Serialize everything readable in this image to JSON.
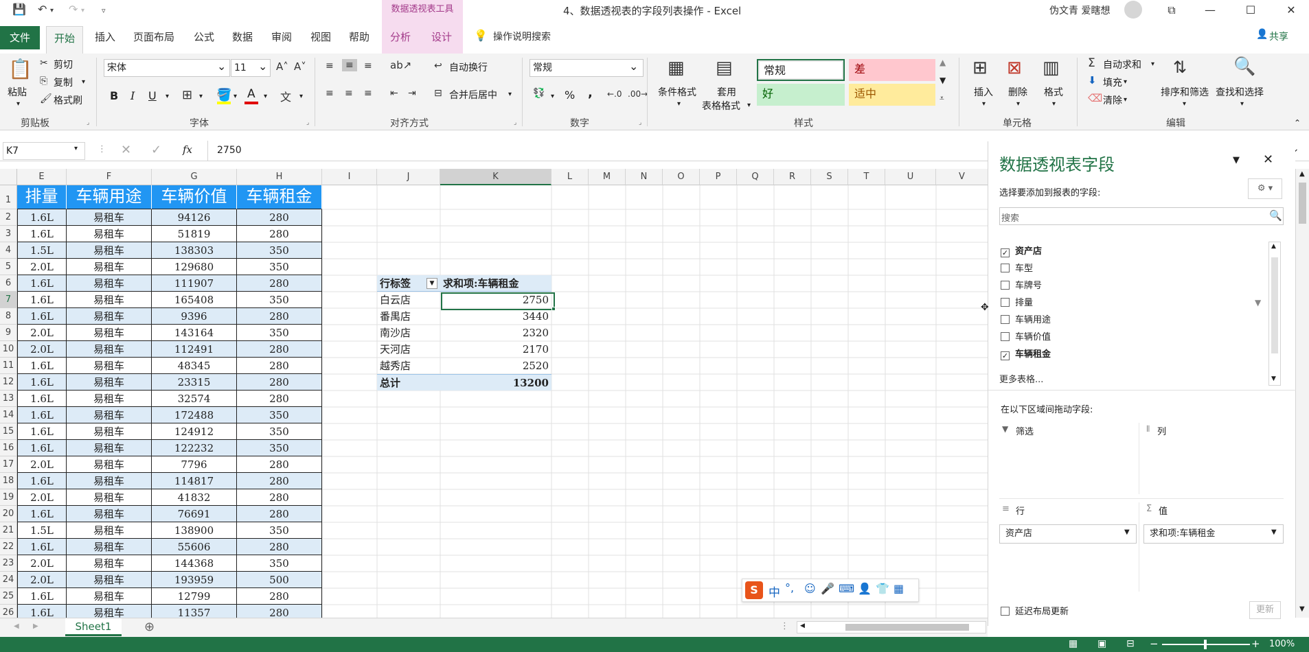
{
  "window": {
    "title": "4、数据透视表的字段列表操作  -  Excel",
    "context_tool": "数据透视表工具",
    "user": "伪文青 爱瞎想",
    "accent": "#217346"
  },
  "tabs": [
    "文件",
    "开始",
    "插入",
    "页面布局",
    "公式",
    "数据",
    "审阅",
    "视图",
    "帮助",
    "分析",
    "设计"
  ],
  "tell_me": "操作说明搜索",
  "share": "共享",
  "ribbon": {
    "clipboard": {
      "paste": "粘贴",
      "cut": "剪切",
      "copy": "复制",
      "format_painter": "格式刷",
      "label": "剪贴板"
    },
    "font": {
      "name": "宋体",
      "size": "11",
      "label": "字体",
      "bold": "B",
      "italic": "I",
      "underline": "U"
    },
    "alignment": {
      "wrap": "自动换行",
      "merge": "合并后居中",
      "label": "对齐方式"
    },
    "number": {
      "format": "常规",
      "percent": "%",
      "comma": ",",
      "label": "数字"
    },
    "styles": {
      "cond_format": "条件格式",
      "table_format_1": "套用",
      "table_format_2": "表格格式",
      "normal": "常规",
      "bad": "差",
      "good": "好",
      "neutral": "适中",
      "label": "样式"
    },
    "cells": {
      "insert": "插入",
      "delete": "删除",
      "format": "格式",
      "label": "单元格"
    },
    "editing": {
      "autosum": "自动求和",
      "fill": "填充",
      "clear": "清除",
      "sort_filter": "排序和筛选",
      "find_select": "查找和选择",
      "label": "编辑"
    }
  },
  "formula_bar": {
    "name_box": "K7",
    "formula": "2750"
  },
  "columns": [
    "E",
    "F",
    "G",
    "H",
    "I",
    "J",
    "K",
    "L",
    "M",
    "N",
    "O",
    "P",
    "Q",
    "R",
    "S",
    "T",
    "U",
    "V"
  ],
  "row_numbers": [
    "1",
    "2",
    "3",
    "4",
    "5",
    "6",
    "7",
    "8",
    "9",
    "10",
    "11",
    "12",
    "13",
    "14",
    "15",
    "16",
    "17",
    "18",
    "19",
    "20",
    "21",
    "22",
    "23",
    "24",
    "25",
    "26"
  ],
  "table": {
    "headers": [
      "排量",
      "车辆用途",
      "车辆价值",
      "车辆租金"
    ],
    "rows": [
      [
        "1.6L",
        "易租车",
        "94126",
        "280"
      ],
      [
        "1.6L",
        "易租车",
        "51819",
        "280"
      ],
      [
        "1.5L",
        "易租车",
        "138303",
        "350"
      ],
      [
        "2.0L",
        "易租车",
        "129680",
        "350"
      ],
      [
        "1.6L",
        "易租车",
        "111907",
        "280"
      ],
      [
        "1.6L",
        "易租车",
        "165408",
        "350"
      ],
      [
        "1.6L",
        "易租车",
        "9396",
        "280"
      ],
      [
        "2.0L",
        "易租车",
        "143164",
        "350"
      ],
      [
        "2.0L",
        "易租车",
        "112491",
        "280"
      ],
      [
        "1.6L",
        "易租车",
        "48345",
        "280"
      ],
      [
        "1.6L",
        "易租车",
        "23315",
        "280"
      ],
      [
        "1.6L",
        "易租车",
        "32574",
        "280"
      ],
      [
        "1.6L",
        "易租车",
        "172488",
        "350"
      ],
      [
        "1.6L",
        "易租车",
        "124912",
        "350"
      ],
      [
        "1.6L",
        "易租车",
        "122232",
        "350"
      ],
      [
        "2.0L",
        "易租车",
        "7796",
        "280"
      ],
      [
        "1.6L",
        "易租车",
        "114817",
        "280"
      ],
      [
        "2.0L",
        "易租车",
        "41832",
        "280"
      ],
      [
        "1.6L",
        "易租车",
        "76691",
        "280"
      ],
      [
        "1.5L",
        "易租车",
        "138900",
        "350"
      ],
      [
        "1.6L",
        "易租车",
        "55606",
        "280"
      ],
      [
        "2.0L",
        "易租车",
        "144368",
        "350"
      ],
      [
        "2.0L",
        "易租车",
        "193959",
        "500"
      ],
      [
        "1.6L",
        "易租车",
        "12799",
        "280"
      ],
      [
        "1.6L",
        "易租车",
        "11357",
        "280"
      ]
    ]
  },
  "pivot": {
    "row_label": "行标签",
    "value_label": "求和项:车辆租金",
    "rows": [
      {
        "label": "白云店",
        "value": "2750"
      },
      {
        "label": "番禺店",
        "value": "3440"
      },
      {
        "label": "南沙店",
        "value": "2320"
      },
      {
        "label": "天河店",
        "value": "2170"
      },
      {
        "label": "越秀店",
        "value": "2520"
      }
    ],
    "total_label": "总计",
    "total_value": "13200"
  },
  "sheet_tab": "Sheet1",
  "zoom": "100%",
  "pane": {
    "title": "数据透视表字段",
    "subtitle": "选择要添加到报表的字段:",
    "search_placeholder": "搜索",
    "fields": [
      {
        "name": "资产店",
        "checked": true
      },
      {
        "name": "车型",
        "checked": false
      },
      {
        "name": "车牌号",
        "checked": false
      },
      {
        "name": "排量",
        "checked": false
      },
      {
        "name": "车辆用途",
        "checked": false
      },
      {
        "name": "车辆价值",
        "checked": false
      },
      {
        "name": "车辆租金",
        "checked": true
      }
    ],
    "more_tables": "更多表格...",
    "drag_hint": "在以下区域间拖动字段:",
    "area_filter": "筛选",
    "area_columns": "列",
    "area_rows": "行",
    "area_values": "值",
    "row_field": "资产店",
    "value_field": "求和项:车辆租金",
    "defer": "延迟布局更新",
    "update": "更新"
  },
  "ime": {
    "lang": "中"
  }
}
